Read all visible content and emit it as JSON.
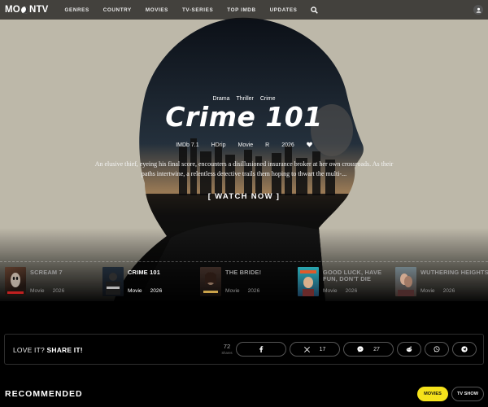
{
  "header": {
    "logo_left": "MO",
    "logo_right": "NTV",
    "nav": [
      "GENRES",
      "COUNTRY",
      "MOVIES",
      "TV-SERIES",
      "TOP IMDB",
      "UPDATES"
    ]
  },
  "hero": {
    "genres": [
      "Drama",
      "Thriller",
      "Crime"
    ],
    "title": "Crime 101",
    "meta": {
      "imdb": "IMDb 7.1",
      "quality": "HDrip",
      "type": "Movie",
      "rating": "R",
      "year": "2026"
    },
    "description": "An elusive thief, eyeing his final score, encounters a disillusioned insurance broker at her own crossroads. As their paths intertwine, a relentless detective trails them hoping to thwart the multi-...",
    "watch_label": "[ WATCH NOW ]"
  },
  "strip": [
    {
      "title": "SCREAM 7",
      "type": "Movie",
      "year": "2026"
    },
    {
      "title": "CRIME 101",
      "type": "Movie",
      "year": "2026"
    },
    {
      "title": "THE BRIDE!",
      "type": "Movie",
      "year": "2026"
    },
    {
      "title": "GOOD LUCK, HAVE FUN, DON'T DIE",
      "type": "Movie",
      "year": "2026"
    },
    {
      "title": "WUTHERING HEIGHTS",
      "type": "Movie",
      "year": "2026"
    }
  ],
  "share": {
    "label_plain": "LOVE IT?",
    "label_bold": "SHARE IT!",
    "total": "72",
    "total_label": "Shares",
    "x_count": "17",
    "messenger_count": "27"
  },
  "recommended": {
    "title": "RECOMMENDED",
    "tab_movies": "MOVIES",
    "tab_tv": "TV SHOW"
  },
  "colors": {
    "accent": "#f5e21b",
    "hero_bg": "#bdb8a9"
  },
  "icons": {
    "search": "search-icon",
    "user": "user-icon",
    "heart": "heart-icon",
    "facebook": "facebook-icon",
    "x": "x-icon",
    "messenger": "messenger-icon",
    "reddit": "reddit-icon",
    "whatsapp": "whatsapp-icon",
    "telegram": "telegram-icon"
  }
}
